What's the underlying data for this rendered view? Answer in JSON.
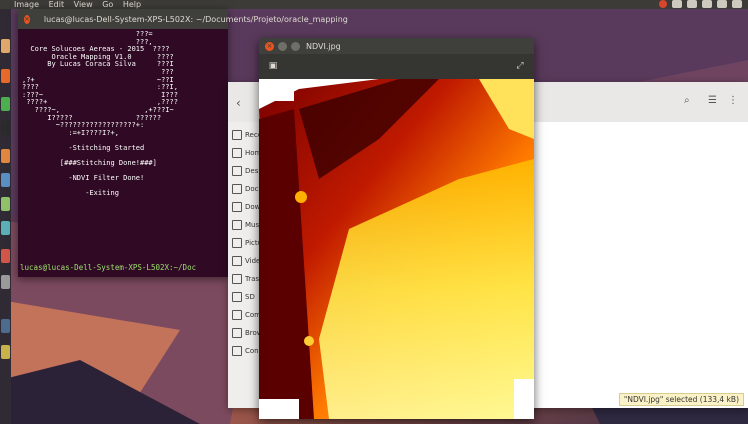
{
  "topbar": {
    "menus": [
      "Image",
      "Edit",
      "View",
      "Go",
      "Help"
    ],
    "tray_icons": [
      "chrome-icon",
      "wifi-icon",
      "network-icon",
      "battery-icon",
      "sound-icon",
      "power-icon"
    ]
  },
  "launcher": {
    "icons": [
      "files-icon",
      "firefox-icon",
      "chrome-icon",
      "terminal-icon",
      "software-center-icon",
      "settings-icon",
      "text-editor-icon",
      "calculator-icon",
      "image-viewer-icon",
      "usb-icon",
      "system-icon",
      "trash-icon"
    ]
  },
  "terminal": {
    "title": "lucas@lucas-Dell-System-XPS-L502X: ~/Documents/Projeto/oracle_mapping",
    "lines": [
      "                           ???=",
      "                           ???,",
      "  Core Solucoes Aereas - 2015  ????",
      "       Oracle Mapping V1.0      ????",
      "      By Lucas Coraca Silva     ???I",
      "                                 ???",
      ",?+                             ~??I",
      "????                            :??I,",
      ":???~                            I???",
      " ????+                          ,????",
      "   ????~,                    ,+???I~",
      "      I?????               ??????",
      "        ~??????????????????+:",
      "           :=+I????I?+,",
      "",
      "           -Stitching Started",
      "",
      "         [###Stitching Done!###]",
      "",
      "           -NDVI Filter Done!",
      "",
      "               -Exiting"
    ],
    "prompt": "lucas@lucas-Dell-System-XPS-L502X:~/Doc"
  },
  "files": {
    "sidebar": [
      {
        "label": "Recent",
        "icon": "clock-icon"
      },
      {
        "label": "Home",
        "icon": "home-icon"
      },
      {
        "label": "Desktop",
        "icon": "desktop-icon"
      },
      {
        "label": "Documents",
        "icon": "document-icon"
      },
      {
        "label": "Downloads",
        "icon": "download-icon"
      },
      {
        "label": "Music",
        "icon": "music-icon"
      },
      {
        "label": "Pictures",
        "icon": "camera-icon"
      },
      {
        "label": "Videos",
        "icon": "video-icon"
      },
      {
        "label": "Trash",
        "icon": "trash-icon"
      },
      {
        "label": "SD",
        "icon": "drive-icon"
      },
      {
        "label": "Computer",
        "icon": "computer-icon"
      },
      {
        "label": "Browse",
        "icon": "network-icon"
      },
      {
        "label": "Connect",
        "icon": "plug-icon"
      }
    ],
    "status": "\"NDVI.jpg\" selected (133,4 kB)"
  },
  "viewer": {
    "title": "NDVI.jpg"
  }
}
